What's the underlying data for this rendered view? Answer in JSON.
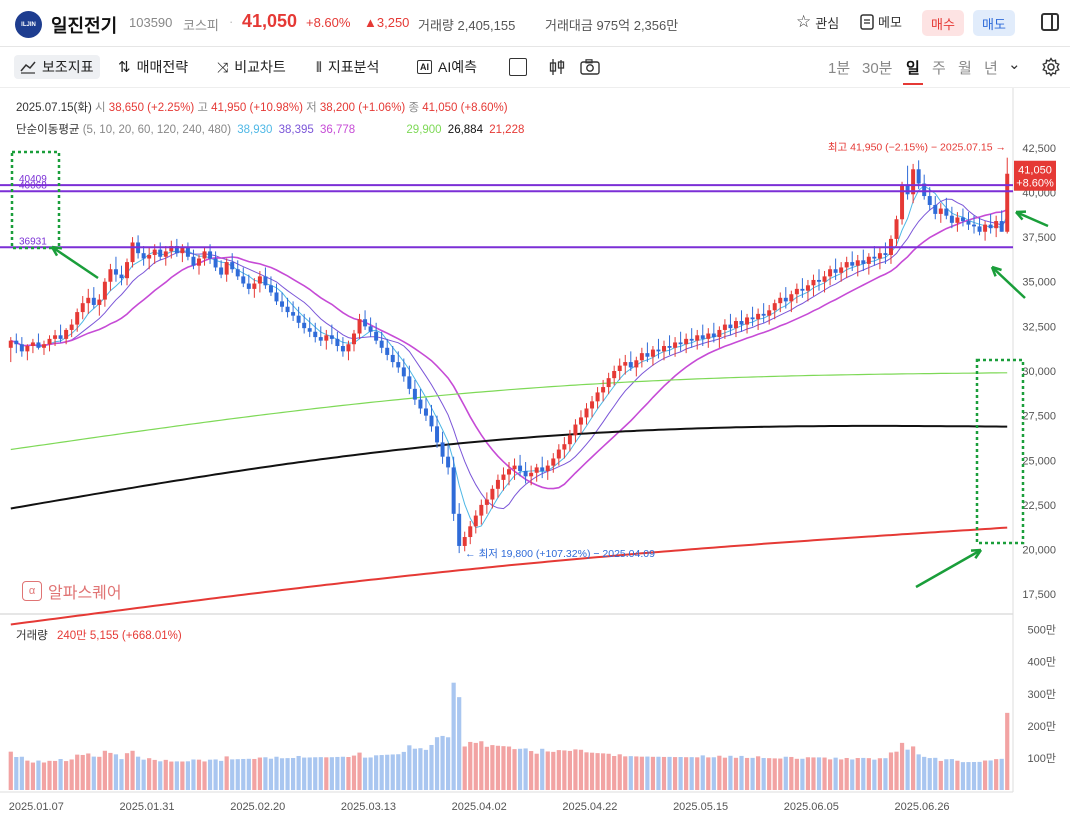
{
  "header": {
    "logo_text": "ILJIN",
    "stock_name": "일진전기",
    "code": "103590",
    "market": "코스피",
    "separator": "·",
    "price": "41,050",
    "change_pct": "+8.60%",
    "change_amt": "▲3,250",
    "volume": "거래량 2,405,155",
    "trade_amount": "거래대금 975억 2,356만",
    "interest_label": "관심",
    "memo_label": "메모",
    "buy_label": "매수",
    "sell_label": "매도"
  },
  "toolbar": {
    "indicators": "보조지표",
    "strategy": "매매전략",
    "compare": "비교차트",
    "analysis": "지표분석",
    "ai_predict": "AI예측",
    "periods": [
      "1분",
      "30분",
      "일",
      "주",
      "월",
      "년"
    ],
    "active_period": "일"
  },
  "info": {
    "date": "2025.07.15(화)",
    "open_label": "시",
    "open": "38,650 (+2.25%)",
    "high_label": "고",
    "high": "41,950 (+10.98%)",
    "low_label": "저",
    "low": "38,200 (+1.06%)",
    "close_label": "종",
    "close": "41,050 (+8.60%)",
    "ma_label": "단순이동평균",
    "ma_periods": "(5, 10, 20, 60, 120, 240, 480)",
    "ma_values": [
      "38,930",
      "38,395",
      "36,778",
      "29,900",
      "26,884",
      "21,228"
    ],
    "ma_colors": [
      "#4fb8e6",
      "#7b56d8",
      "#c64bd6",
      "#7ed957",
      "#111111",
      "#e53935"
    ]
  },
  "volume_info": {
    "label": "거래량",
    "value": "240만 5,155 (+668.01%)"
  },
  "watermark": "알파스퀘어",
  "colors": {
    "up": "#e53935",
    "down": "#2f6bd8",
    "hline": "#7b2fd6",
    "annotation": "#1a9e3a"
  },
  "chart_data": {
    "type": "candlestick",
    "title": "",
    "price_ylim": [
      16500,
      43500
    ],
    "price_ticks": [
      "42,500",
      "40,000",
      "37,500",
      "35,000",
      "32,500",
      "30,000",
      "27,500",
      "25,000",
      "22,500",
      "20,000",
      "17,500"
    ],
    "price_tick_values": [
      42500,
      40000,
      37500,
      35000,
      32500,
      30000,
      27500,
      25000,
      22500,
      20000,
      17500
    ],
    "volume_ylim": [
      0,
      5300000
    ],
    "volume_ticks": [
      "500만",
      "400만",
      "300만",
      "200만",
      "100만"
    ],
    "volume_tick_values": [
      5000000,
      4000000,
      3000000,
      2000000,
      1000000
    ],
    "x_labels": [
      "2025.01.07",
      "2025.01.31",
      "2025.02.20",
      "2025.03.13",
      "2025.04.02",
      "2025.04.22",
      "2025.05.15",
      "2025.06.05",
      "2025.06.26"
    ],
    "x_label_index": [
      0,
      20,
      40,
      60,
      80,
      100,
      120,
      140,
      160
    ],
    "horizontal_lines": [
      40409,
      40068,
      36931
    ],
    "horizontal_line_labels": [
      "40409",
      "40068",
      "36931"
    ],
    "max_annotation": "최고 41,950 (−2.15%) − 2025.07.15 →",
    "min_annotation": "← 최저 19,800 (+107.32%) − 2025.04.09",
    "last_price_label": "41,050",
    "last_pct_label": "+8.60%",
    "candles": [
      [
        31300,
        31900,
        30500,
        31700
      ],
      [
        31700,
        32100,
        31000,
        31500
      ],
      [
        31500,
        31900,
        30800,
        31100
      ],
      [
        31100,
        31500,
        30600,
        31400
      ],
      [
        31400,
        31800,
        31000,
        31600
      ],
      [
        31600,
        32100,
        31200,
        31300
      ],
      [
        31300,
        31700,
        30900,
        31500
      ],
      [
        31500,
        32000,
        31100,
        31800
      ],
      [
        31800,
        32300,
        31400,
        32000
      ],
      [
        32000,
        32600,
        31600,
        31800
      ],
      [
        31800,
        32400,
        31500,
        32300
      ],
      [
        32300,
        32900,
        31900,
        32600
      ],
      [
        32600,
        33500,
        32200,
        33300
      ],
      [
        33300,
        34200,
        32900,
        33800
      ],
      [
        33800,
        34600,
        33200,
        34100
      ],
      [
        34100,
        34700,
        33500,
        33700
      ],
      [
        33700,
        34300,
        33100,
        34000
      ],
      [
        34000,
        35200,
        33600,
        35000
      ],
      [
        35000,
        36000,
        34500,
        35700
      ],
      [
        35700,
        36400,
        35000,
        35400
      ],
      [
        35400,
        35900,
        34800,
        35200
      ],
      [
        35200,
        36300,
        34800,
        36100
      ],
      [
        36100,
        37500,
        35800,
        37200
      ],
      [
        37200,
        37600,
        36300,
        36600
      ],
      [
        36600,
        37000,
        35900,
        36300
      ],
      [
        36300,
        36900,
        35700,
        36500
      ],
      [
        36500,
        37100,
        36000,
        36800
      ],
      [
        36800,
        37200,
        36200,
        36400
      ],
      [
        36400,
        37000,
        35900,
        36700
      ],
      [
        36700,
        37300,
        36300,
        37000
      ],
      [
        37000,
        37400,
        36400,
        36600
      ],
      [
        36600,
        37100,
        36100,
        36900
      ],
      [
        36900,
        37200,
        36200,
        36400
      ],
      [
        36400,
        36800,
        35700,
        35900
      ],
      [
        35900,
        36500,
        35400,
        36300
      ],
      [
        36300,
        36900,
        35900,
        36700
      ],
      [
        36700,
        37100,
        36000,
        36300
      ],
      [
        36300,
        36700,
        35600,
        35800
      ],
      [
        35800,
        36200,
        35200,
        35400
      ],
      [
        35400,
        36300,
        35000,
        36100
      ],
      [
        36100,
        36600,
        35500,
        35700
      ],
      [
        35700,
        36200,
        35100,
        35300
      ],
      [
        35300,
        35800,
        34700,
        34900
      ],
      [
        34900,
        35400,
        34300,
        34600
      ],
      [
        34600,
        35200,
        34100,
        34900
      ],
      [
        34900,
        35600,
        34400,
        35300
      ],
      [
        35300,
        35800,
        34600,
        34800
      ],
      [
        34800,
        35300,
        34200,
        34400
      ],
      [
        34400,
        34900,
        33700,
        33900
      ],
      [
        33900,
        34400,
        33300,
        33600
      ],
      [
        33600,
        34100,
        33000,
        33300
      ],
      [
        33300,
        33900,
        32800,
        33100
      ],
      [
        33100,
        33600,
        32400,
        32700
      ],
      [
        32700,
        33200,
        32100,
        32400
      ],
      [
        32400,
        33000,
        31900,
        32200
      ],
      [
        32200,
        32700,
        31600,
        31900
      ],
      [
        31900,
        32500,
        31400,
        31700
      ],
      [
        31700,
        32300,
        31200,
        32000
      ],
      [
        32000,
        32600,
        31500,
        31800
      ],
      [
        31800,
        32200,
        31100,
        31400
      ],
      [
        31400,
        31900,
        30800,
        31100
      ],
      [
        31100,
        31700,
        30600,
        31500
      ],
      [
        31500,
        32300,
        31100,
        32100
      ],
      [
        32100,
        33200,
        31800,
        32900
      ],
      [
        32900,
        33400,
        32300,
        32500
      ],
      [
        32500,
        33000,
        31900,
        32200
      ],
      [
        32200,
        32700,
        31500,
        31700
      ],
      [
        31700,
        32200,
        31000,
        31300
      ],
      [
        31300,
        31800,
        30600,
        30900
      ],
      [
        30900,
        31400,
        30200,
        30500
      ],
      [
        30500,
        31100,
        29900,
        30200
      ],
      [
        30200,
        30700,
        29400,
        29700
      ],
      [
        29700,
        30300,
        28700,
        29000
      ],
      [
        29000,
        29500,
        28100,
        28400
      ],
      [
        28400,
        29000,
        27600,
        27900
      ],
      [
        27900,
        28500,
        27200,
        27500
      ],
      [
        27500,
        28100,
        26600,
        26900
      ],
      [
        26900,
        27500,
        25700,
        26000
      ],
      [
        26000,
        26600,
        24800,
        25200
      ],
      [
        25200,
        25900,
        24200,
        24600
      ],
      [
        24600,
        25200,
        21600,
        22000
      ],
      [
        22000,
        22600,
        19800,
        20200
      ],
      [
        20200,
        21000,
        19900,
        20700
      ],
      [
        20700,
        21600,
        20300,
        21300
      ],
      [
        21300,
        22200,
        20900,
        21900
      ],
      [
        21900,
        22800,
        21400,
        22500
      ],
      [
        22500,
        23200,
        22000,
        22800
      ],
      [
        22800,
        23600,
        22300,
        23400
      ],
      [
        23400,
        24200,
        22900,
        23900
      ],
      [
        23900,
        24600,
        23300,
        24200
      ],
      [
        24200,
        24900,
        23600,
        24500
      ],
      [
        24500,
        25100,
        23900,
        24700
      ],
      [
        24700,
        25300,
        24100,
        24400
      ],
      [
        24400,
        24900,
        23700,
        24100
      ],
      [
        24100,
        24700,
        23600,
        24300
      ],
      [
        24300,
        24800,
        23800,
        24600
      ],
      [
        24600,
        25200,
        24000,
        24400
      ],
      [
        24400,
        25000,
        23900,
        24700
      ],
      [
        24700,
        25400,
        24300,
        25100
      ],
      [
        25100,
        25900,
        24700,
        25600
      ],
      [
        25600,
        26300,
        25100,
        25900
      ],
      [
        25900,
        26700,
        25500,
        26400
      ],
      [
        26400,
        27300,
        26000,
        27000
      ],
      [
        27000,
        27800,
        26500,
        27400
      ],
      [
        27400,
        28200,
        27000,
        27900
      ],
      [
        27900,
        28600,
        27400,
        28300
      ],
      [
        28300,
        29100,
        27900,
        28800
      ],
      [
        28800,
        29500,
        28300,
        29100
      ],
      [
        29100,
        29900,
        28700,
        29600
      ],
      [
        29600,
        30300,
        29200,
        30000
      ],
      [
        30000,
        30700,
        29500,
        30300
      ],
      [
        30300,
        30900,
        29800,
        30500
      ],
      [
        30500,
        31100,
        30000,
        30200
      ],
      [
        30200,
        30800,
        29700,
        30600
      ],
      [
        30600,
        31300,
        30200,
        31000
      ],
      [
        31000,
        31600,
        30500,
        30800
      ],
      [
        30800,
        31400,
        30300,
        31200
      ],
      [
        31200,
        31800,
        30700,
        31100
      ],
      [
        31100,
        31700,
        30600,
        31400
      ],
      [
        31400,
        32000,
        30900,
        31300
      ],
      [
        31300,
        31900,
        30800,
        31600
      ],
      [
        31600,
        32200,
        31100,
        31500
      ],
      [
        31500,
        32100,
        31000,
        31800
      ],
      [
        31800,
        32400,
        31300,
        31700
      ],
      [
        31700,
        32300,
        31200,
        32000
      ],
      [
        32000,
        32600,
        31400,
        31800
      ],
      [
        31800,
        32400,
        31300,
        32100
      ],
      [
        32100,
        32700,
        31600,
        31900
      ],
      [
        31900,
        32500,
        31300,
        32300
      ],
      [
        32300,
        32900,
        31800,
        32600
      ],
      [
        32600,
        33200,
        32000,
        32400
      ],
      [
        32400,
        33000,
        31900,
        32800
      ],
      [
        32800,
        33400,
        32200,
        32600
      ],
      [
        32600,
        33200,
        32100,
        33000
      ],
      [
        33000,
        33600,
        32500,
        32900
      ],
      [
        32900,
        33500,
        32300,
        33200
      ],
      [
        33200,
        33800,
        32700,
        33100
      ],
      [
        33100,
        33700,
        32600,
        33400
      ],
      [
        33400,
        34000,
        32900,
        33800
      ],
      [
        33800,
        34400,
        33300,
        34100
      ],
      [
        34100,
        34700,
        33500,
        33900
      ],
      [
        33900,
        34500,
        33300,
        34300
      ],
      [
        34300,
        34900,
        33800,
        34600
      ],
      [
        34600,
        35200,
        34100,
        34500
      ],
      [
        34500,
        35100,
        33900,
        34800
      ],
      [
        34800,
        35400,
        34200,
        35100
      ],
      [
        35100,
        35700,
        34500,
        35000
      ],
      [
        35000,
        35600,
        34400,
        35300
      ],
      [
        35300,
        35900,
        34800,
        35700
      ],
      [
        35700,
        36300,
        35100,
        35500
      ],
      [
        35500,
        36100,
        35000,
        35800
      ],
      [
        35800,
        36400,
        35200,
        36100
      ],
      [
        36100,
        36700,
        35600,
        35900
      ],
      [
        35900,
        36500,
        35300,
        36200
      ],
      [
        36200,
        36800,
        35600,
        36000
      ],
      [
        36000,
        36600,
        35400,
        36400
      ],
      [
        36400,
        37000,
        35900,
        36300
      ],
      [
        36300,
        36900,
        35700,
        36600
      ],
      [
        36600,
        37200,
        36000,
        36500
      ],
      [
        36500,
        37600,
        36000,
        37400
      ],
      [
        37400,
        38700,
        37000,
        38500
      ],
      [
        38500,
        40600,
        38200,
        40400
      ],
      [
        40400,
        41500,
        39600,
        39900
      ],
      [
        39900,
        41600,
        39400,
        41300
      ],
      [
        41300,
        41800,
        40200,
        40500
      ],
      [
        40500,
        41000,
        39600,
        39800
      ],
      [
        39800,
        40300,
        39000,
        39300
      ],
      [
        39300,
        39800,
        38500,
        38800
      ],
      [
        38800,
        39400,
        38300,
        39100
      ],
      [
        39100,
        39700,
        38500,
        38700
      ],
      [
        38700,
        39200,
        38000,
        38300
      ],
      [
        38300,
        38900,
        37800,
        38600
      ],
      [
        38600,
        39100,
        38100,
        38400
      ],
      [
        38400,
        38900,
        37900,
        38200
      ],
      [
        38200,
        38700,
        37700,
        38100
      ],
      [
        38100,
        38600,
        37600,
        37800
      ],
      [
        37800,
        38400,
        37300,
        38200
      ],
      [
        38200,
        38800,
        37700,
        38000
      ],
      [
        38000,
        38700,
        37500,
        38400
      ],
      [
        38400,
        39000,
        37800,
        37800
      ],
      [
        37800,
        41950,
        37700,
        41050
      ]
    ]
  }
}
